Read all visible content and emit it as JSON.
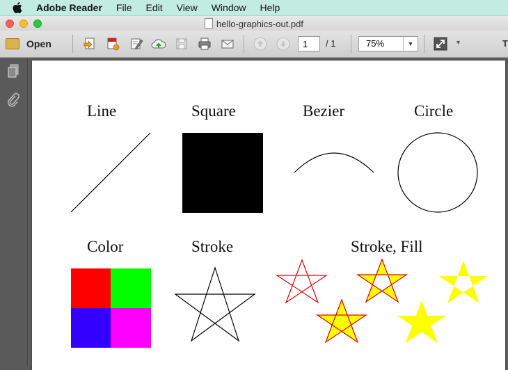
{
  "menubar": {
    "app_name": "Adobe Reader",
    "items": [
      "File",
      "Edit",
      "View",
      "Window",
      "Help"
    ]
  },
  "window": {
    "title": "hello-graphics-out.pdf"
  },
  "toolbar": {
    "open_label": "Open",
    "page_current": "1",
    "page_total": "/ 1",
    "zoom": "75%",
    "tools_label": "T"
  },
  "document": {
    "labels": {
      "line": "Line",
      "square": "Square",
      "bezier": "Bezier",
      "circle": "Circle",
      "color": "Color",
      "stroke": "Stroke",
      "stroke_fill": "Stroke, Fill"
    },
    "colors": {
      "quad_red": "#ff0000",
      "quad_green": "#00ff00",
      "quad_blue": "#3300ff",
      "quad_magenta": "#ff00ff",
      "star_stroke_red": "#e00000",
      "star_fill_yellow": "#ffff00"
    }
  }
}
